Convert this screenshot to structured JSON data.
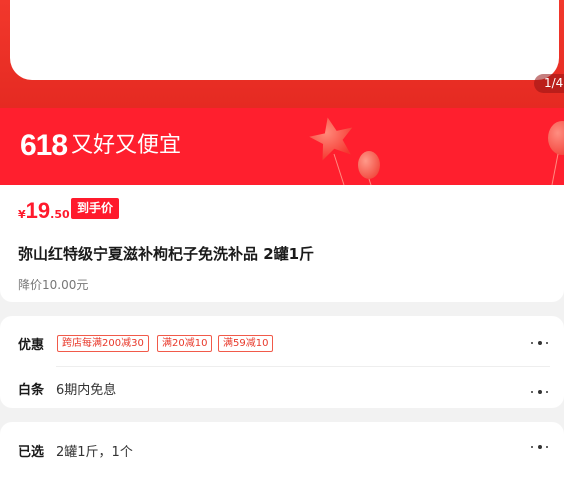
{
  "hero": {
    "image_counter": "1/4"
  },
  "promo": {
    "number": "618",
    "slogan": "又好又便宜"
  },
  "price": {
    "currency": "¥",
    "integer": "19",
    "decimal": ".50",
    "badge": "到手价"
  },
  "product": {
    "title": "弥山红特级宁夏滋补枸杞子免洗补品 2罐1斤",
    "price_reduction": "降价10.00元"
  },
  "offers": {
    "label": "优惠",
    "tags": [
      "跨店每满200减30",
      "满20减10",
      "满59减10"
    ]
  },
  "installment": {
    "label": "白条",
    "value": "6期内免息"
  },
  "selection": {
    "label": "已选",
    "value": "2罐1斤，1个"
  },
  "colors": {
    "brand_red": "#ff1f2e",
    "hero_red": "#e52a22",
    "price_red": "#ff1a2c"
  }
}
